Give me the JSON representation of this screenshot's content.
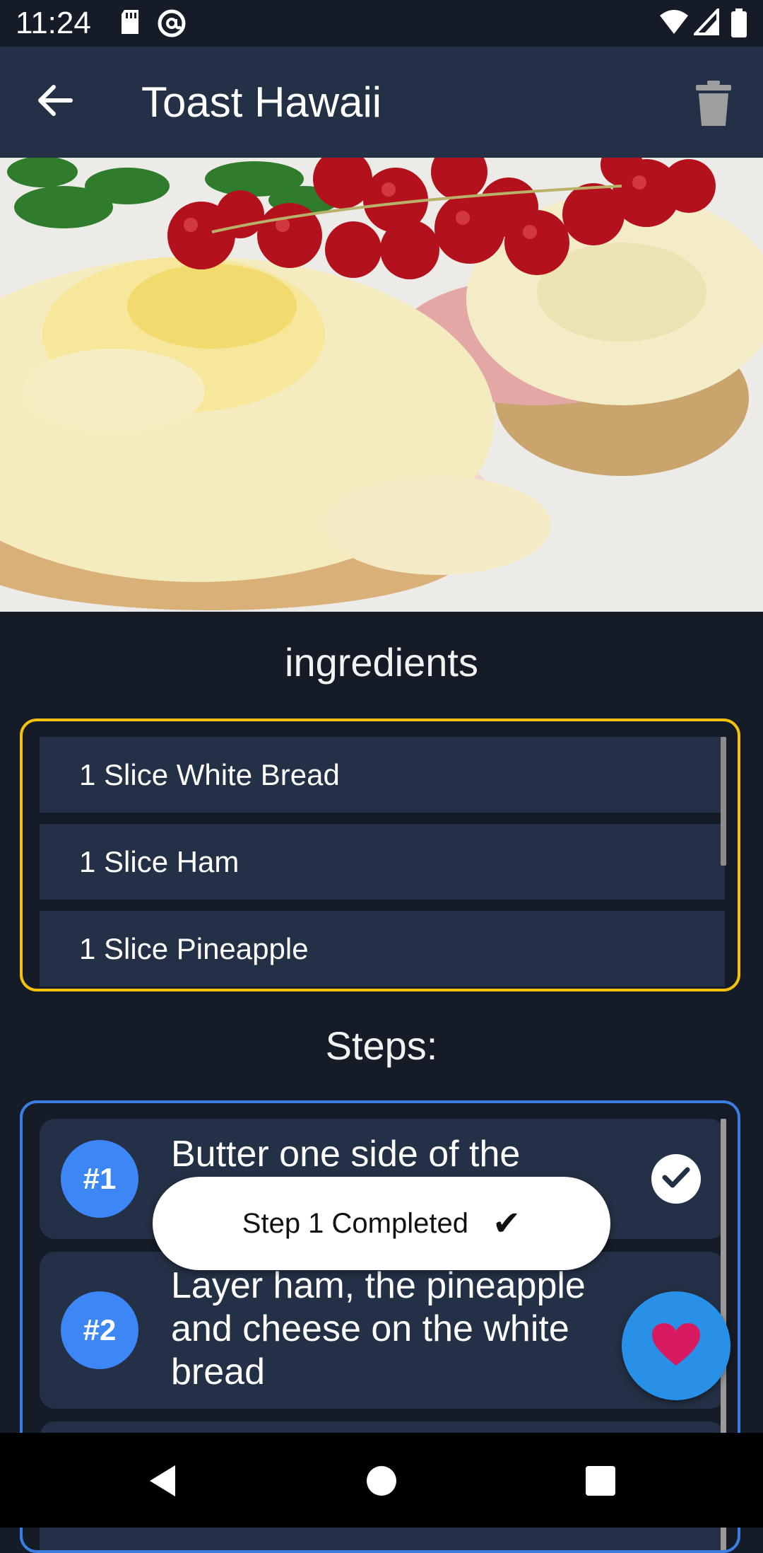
{
  "status_bar": {
    "time": "11:24",
    "left_icons": [
      "sd-card-icon",
      "at-sign-icon"
    ],
    "right_icons": [
      "wifi-icon",
      "cell-signal-icon",
      "battery-icon"
    ]
  },
  "app_bar": {
    "title": "Toast Hawaii",
    "back_icon": "arrow-back-icon",
    "delete_icon": "trash-icon"
  },
  "hero_image": {
    "subject": "Toast Hawaii photo"
  },
  "ingredients": {
    "heading": "ingredients",
    "items": [
      "1 Slice White Bread",
      "1 Slice Ham",
      "1 Slice Pineapple"
    ]
  },
  "steps": {
    "heading": "Steps:",
    "items": [
      {
        "number": "#1",
        "text": "Butter one side of the",
        "completed": true
      },
      {
        "number": "#2",
        "text": "Layer ham, the pineapple and cheese on the white bread",
        "completed": false
      }
    ]
  },
  "toast": {
    "message": "Step 1 Completed",
    "mark": "✔"
  },
  "fab": {
    "icon": "heart-icon"
  },
  "nav_bar": {
    "icons": [
      "nav-back-icon",
      "nav-home-icon",
      "nav-recents-icon"
    ]
  },
  "colors": {
    "background": "#151c28",
    "surface": "#243045",
    "ingredients_border": "#f4c20d",
    "steps_border": "#3b7de0",
    "step_badge": "#3d86f5",
    "fab": "#2990e8",
    "heart": "#d81b60"
  }
}
